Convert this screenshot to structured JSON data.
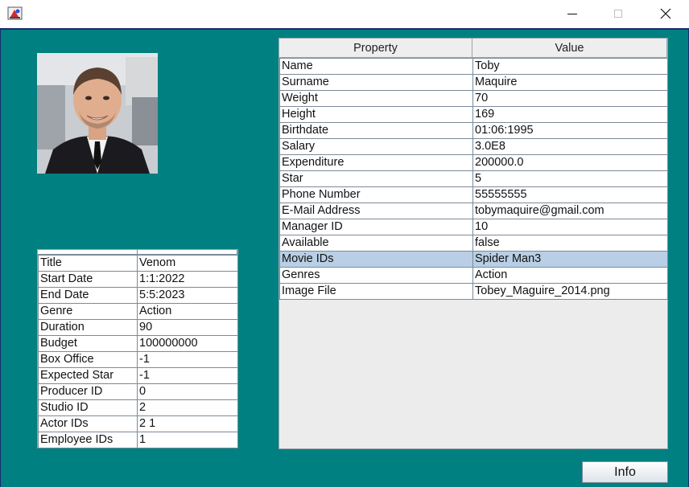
{
  "window": {
    "min_glyph": "—",
    "max_glyph": "☐",
    "close_glyph": "✕"
  },
  "movie_table": {
    "rows": [
      {
        "key": "Title",
        "value": "Venom"
      },
      {
        "key": "Start Date",
        "value": "1:1:2022"
      },
      {
        "key": "End Date",
        "value": "5:5:2023"
      },
      {
        "key": "Genre",
        "value": "Action"
      },
      {
        "key": "Duration",
        "value": "90"
      },
      {
        "key": "Budget",
        "value": "100000000"
      },
      {
        "key": "Box Office",
        "value": "-1"
      },
      {
        "key": "Expected Star",
        "value": "-1"
      },
      {
        "key": "Producer ID",
        "value": "0"
      },
      {
        "key": "Studio ID",
        "value": "2"
      },
      {
        "key": "Actor IDs",
        "value": "2 1"
      },
      {
        "key": "Employee IDs",
        "value": "1"
      }
    ]
  },
  "person_table": {
    "headers": [
      "Property",
      "Value"
    ],
    "selected_row": 12,
    "rows": [
      {
        "key": "Name",
        "value": "Toby"
      },
      {
        "key": "Surname",
        "value": "Maquire"
      },
      {
        "key": "Weight",
        "value": "70"
      },
      {
        "key": "Height",
        "value": "169"
      },
      {
        "key": "Birthdate",
        "value": "01:06:1995"
      },
      {
        "key": "Salary",
        "value": "3.0E8"
      },
      {
        "key": "Expenditure",
        "value": "200000.0"
      },
      {
        "key": "Star",
        "value": "5"
      },
      {
        "key": "Phone Number",
        "value": "55555555"
      },
      {
        "key": "E-Mail Address",
        "value": "tobymaquire@gmail.com"
      },
      {
        "key": "Manager ID",
        "value": "10"
      },
      {
        "key": "Available",
        "value": "false"
      },
      {
        "key": "Movie IDs",
        "value": "Spider Man3"
      },
      {
        "key": "Genres",
        "value": "Action"
      },
      {
        "key": "Image File",
        "value": "Tobey_Maguire_2014.png"
      }
    ]
  },
  "info_button": {
    "label": "Info"
  },
  "colors": {
    "background": "#008080",
    "selection": "#b8cfe5"
  }
}
